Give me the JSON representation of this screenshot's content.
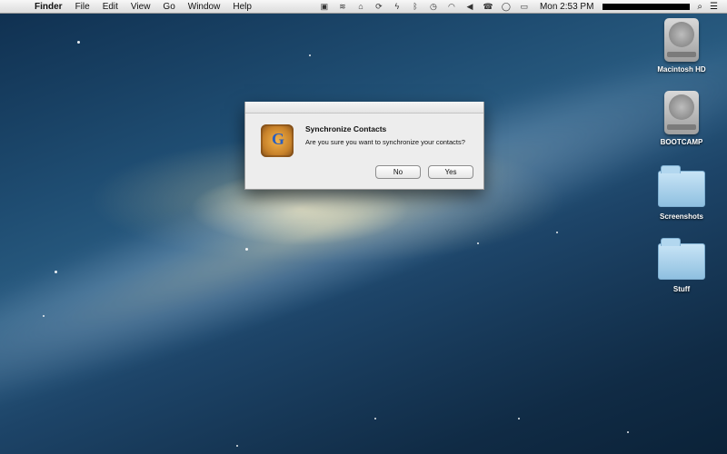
{
  "menubar": {
    "app": "Finder",
    "menus": [
      "File",
      "Edit",
      "View",
      "Go",
      "Window",
      "Help"
    ],
    "clock": "Mon 2:53 PM"
  },
  "desktop_items": [
    {
      "label": "Macintosh HD",
      "type": "drive"
    },
    {
      "label": "BOOTCAMP",
      "type": "drive"
    },
    {
      "label": "Screenshots",
      "type": "folder"
    },
    {
      "label": "Stuff",
      "type": "folder"
    }
  ],
  "dialog": {
    "title": "Synchronize Contacts",
    "message": "Are you sure you want to synchronize your contacts?",
    "buttons": {
      "no": "No",
      "yes": "Yes"
    }
  },
  "icons": {
    "apple": "apple-icon",
    "status": [
      "app-status-icon",
      "airplay-like-icon",
      "airplay-icon",
      "sync-icon",
      "lightning-icon",
      "bluetooth-icon",
      "time-machine-icon",
      "wifi-icon",
      "volume-icon",
      "phone-icon",
      "chat-icon",
      "battery-icon"
    ],
    "spotlight": "spotlight-icon",
    "list": "notification-list-icon"
  }
}
